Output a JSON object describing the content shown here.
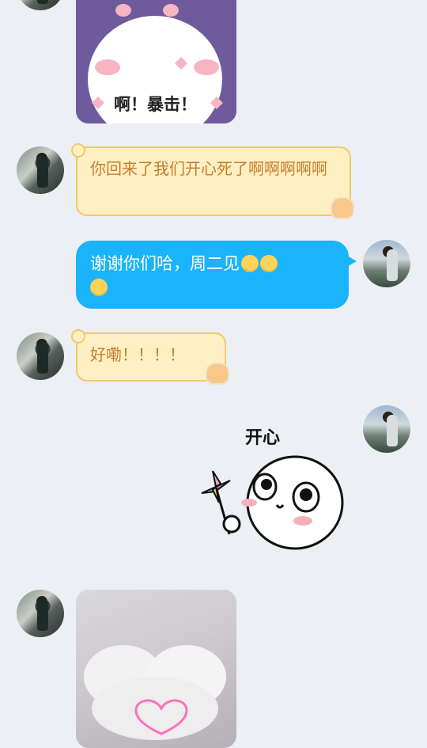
{
  "messages": {
    "m1": {
      "sender": "left",
      "type": "sticker",
      "caption": "啊！暴击！"
    },
    "m2": {
      "sender": "left",
      "type": "text",
      "text": "你回来了我们开心死了啊啊啊啊啊"
    },
    "m3": {
      "sender": "right",
      "type": "text",
      "text": "谢谢你们哈，周二见",
      "emoji_icons": [
        "relieved-face-icon",
        "relieved-face-icon",
        "relieved-face-icon"
      ]
    },
    "m4": {
      "sender": "left",
      "type": "text",
      "text": "好嘞！！！！"
    },
    "m5": {
      "sender": "right",
      "type": "sticker",
      "caption": "开心"
    },
    "m6": {
      "sender": "left",
      "type": "image",
      "description_icon": "heart-hands-icon"
    }
  },
  "colors": {
    "background": "#eceff4",
    "blue_bubble": "#19b4fb",
    "yellow_bubble": "#fff0c4",
    "yellow_text": "#c57d2c"
  }
}
